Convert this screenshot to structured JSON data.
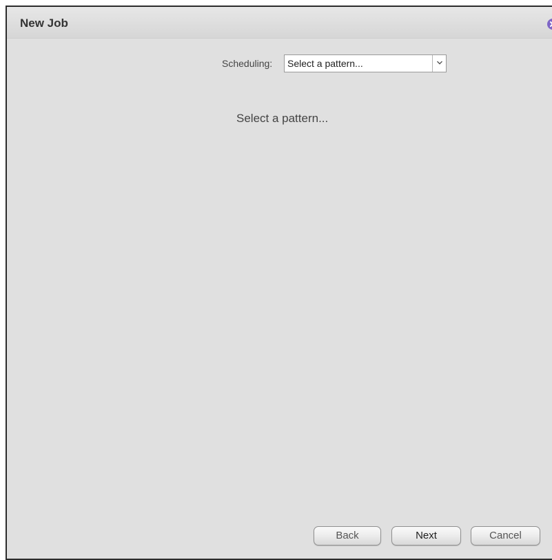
{
  "dialog": {
    "title": "New Job",
    "close_icon": "close-icon",
    "close_color": "#7e66c6"
  },
  "scheduling": {
    "label": "Scheduling:",
    "selected": "Select a pattern...",
    "arrow_icon": "chevron-down-icon"
  },
  "content": {
    "message": "Select a pattern..."
  },
  "footer": {
    "back_label": "Back",
    "next_label": "Next",
    "cancel_label": "Cancel"
  }
}
